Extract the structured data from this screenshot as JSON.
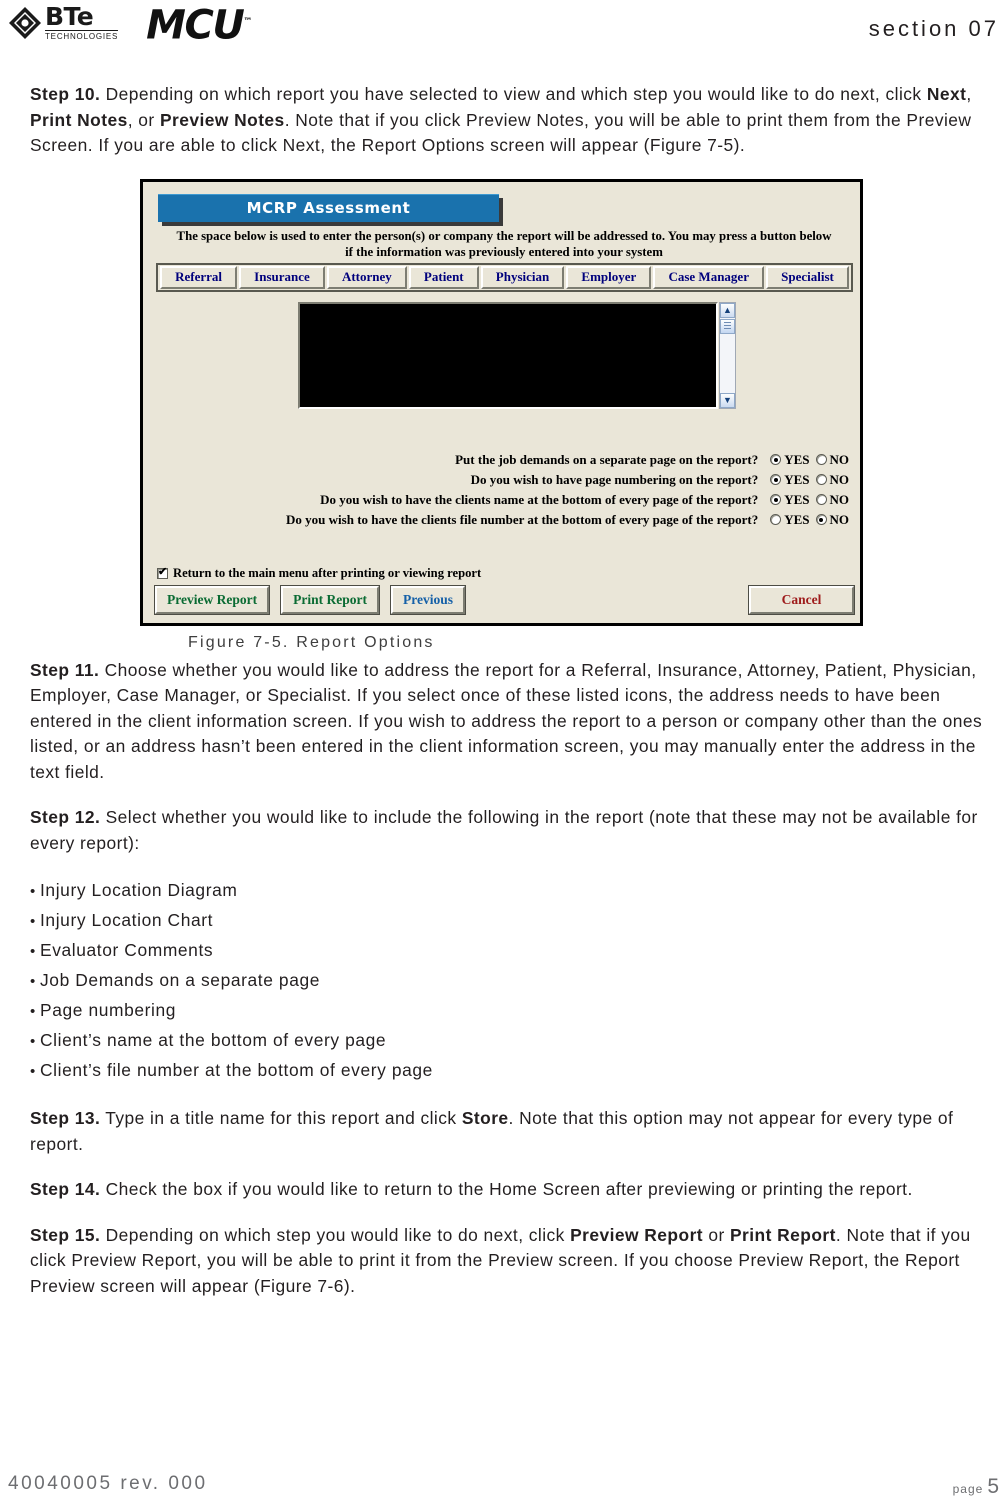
{
  "header": {
    "brand_primary": "BTe",
    "brand_primary_sub": "TECHNOLOGIES",
    "brand_secondary": "MCU",
    "brand_secondary_tm": "™",
    "section_label": "section 07"
  },
  "steps": {
    "step10": {
      "label": "Step 10.",
      "text_1": " Depending on which report you have selected to view and which step you would like to do next, click ",
      "bold_1": "Next",
      "text_2": ", ",
      "bold_2": "Print Notes",
      "text_3": ", or ",
      "bold_3": "Preview Notes",
      "text_4": ". Note that if you click Preview Notes, you will be able to print them from the Preview Screen. If you are able to click Next, the Report Options screen will appear (Figure 7-5)."
    },
    "step11": {
      "label": "Step 11.",
      "text_1": " Choose whether you would like to address the report for a Referral, Insurance, Attorney, Patient, Physician, Employer, Case Manager, or Specialist. If you select once of these listed icons, the address needs to have been entered in the client information screen. If you wish to address the report to a person or company other than the ones listed, or an address hasn’t been entered in the client information screen, you may manually enter the address in the text field."
    },
    "step12": {
      "label": "Step 12.",
      "text_1": " Select whether you would like to include the following in the report (note that these may not be available for every report):"
    },
    "step13": {
      "label": "Step 13.",
      "text_1": " Type in a title name for this report and click ",
      "bold_1": "Store",
      "text_2": ". Note that this option may not appear for every type of report."
    },
    "step14": {
      "label": "Step 14.",
      "text_1": " Check the box if you would like to return to the Home Screen after previewing or printing the report."
    },
    "step15": {
      "label": "Step 15.",
      "text_1": " Depending on which step you would like to do next, click ",
      "bold_1": "Preview Report",
      "text_2": " or ",
      "bold_2": "Print Report",
      "text_3": ". Note that if you click Preview Report, you will be able to print it from the Preview screen. If you choose Preview Report, the Report Preview screen will appear (Figure 7-6)."
    }
  },
  "bullet_list": [
    "Injury Location Diagram",
    "Injury Location Chart",
    "Evaluator Comments",
    "Job Demands on a separate page",
    "Page numbering",
    "Client’s name at the bottom of every page",
    "Client’s file number at the bottom of every page"
  ],
  "figure": {
    "caption": "Figure 7-5. Report Options",
    "dialog": {
      "title": "MCRP Assessment",
      "instructions_line1": "The space below is used to enter the person(s) or company the report will be addressed to. You may press a button below",
      "instructions_line2": "if the information was previously entered into your system",
      "address_buttons": [
        {
          "label": "Referral",
          "accel": "R"
        },
        {
          "label": "Insurance",
          "accel": "I"
        },
        {
          "label": "Attorney",
          "accel": "t"
        },
        {
          "label": "Patient",
          "accel": "a"
        },
        {
          "label": "Physician",
          "accel": "h"
        },
        {
          "label": "Employer",
          "accel": ""
        },
        {
          "label": "Case Manager",
          "accel": "M"
        },
        {
          "label": "Specialist",
          "accel": "S"
        }
      ],
      "address_textarea_value": "",
      "scrollbar": {
        "up_icon": "chevron-up-icon",
        "down_icon": "chevron-down-icon"
      },
      "questions": [
        {
          "label": "Put the job demands on a separate page on the report?",
          "yes_label": "YES",
          "no_label": "NO",
          "selected": "YES"
        },
        {
          "label": "Do you wish to have page numbering on the report?",
          "yes_label": "YES",
          "no_label": "NO",
          "selected": "YES"
        },
        {
          "label": "Do you wish to have the clients name at the bottom of every page of the report?",
          "yes_label": "YES",
          "no_label": "NO",
          "selected": "YES"
        },
        {
          "label": "Do you wish to have the clients file number at the bottom of every page of the report?",
          "yes_label": "YES",
          "no_label": "NO",
          "selected": "NO"
        }
      ],
      "return_checkbox": {
        "label": "Return to the main menu after printing or viewing report",
        "checked": true
      },
      "actions": [
        {
          "label": "Preview Report",
          "color": "#0a6b33",
          "accel": "v"
        },
        {
          "label": "Print Report",
          "color": "#0a6b33",
          "accel": "R"
        },
        {
          "label": "Previous",
          "color": "#1560a8",
          "accel": "P"
        },
        {
          "label": "Cancel",
          "color": "#9e1b1b",
          "accel": "C"
        }
      ]
    }
  },
  "footer": {
    "doc_id": "40040005 rev. 000",
    "page_word": "page",
    "page_number": "5"
  }
}
